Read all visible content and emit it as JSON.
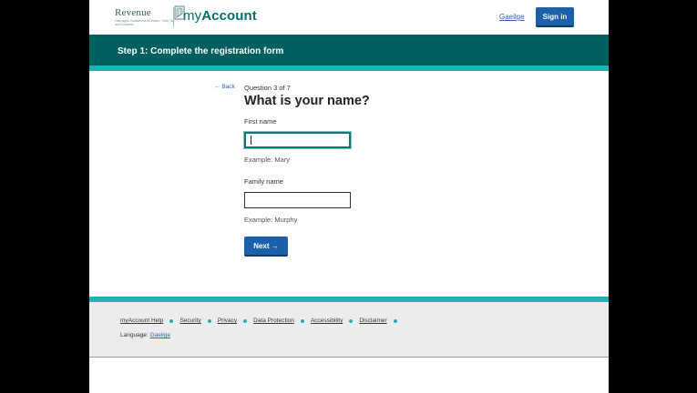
{
  "header": {
    "logo_word": "Revenue",
    "logo_sub": "Cáin agus Custaim na hÉireann · Irish Tax and Customs",
    "brand_prefix": "my",
    "brand_suffix": "Account",
    "language_link": "Gaeilge",
    "sign_in_label": "Sign in"
  },
  "banner": {
    "step_title": "Step 1: Complete the registration form"
  },
  "form": {
    "back_label": "Back",
    "question_count": "Question 3 of 7",
    "question_title": "What is your name?",
    "first_name": {
      "label": "First name",
      "value": "",
      "hint": "Example: Mary"
    },
    "family_name": {
      "label": "Family name",
      "value": "",
      "hint": "Example: Murphy"
    },
    "next_label": "Next"
  },
  "footer": {
    "links": [
      "myAccount Help",
      "Security",
      "Privacy",
      "Data Protection",
      "Accessibility",
      "Disclaimer"
    ],
    "language_prefix": "Language:",
    "language_link": "Gaeilge"
  },
  "colors": {
    "teal_dark": "#005f5f",
    "teal_accent": "#22b1b1",
    "button_blue": "#1d5fa8",
    "link_blue": "#2f63b7"
  }
}
